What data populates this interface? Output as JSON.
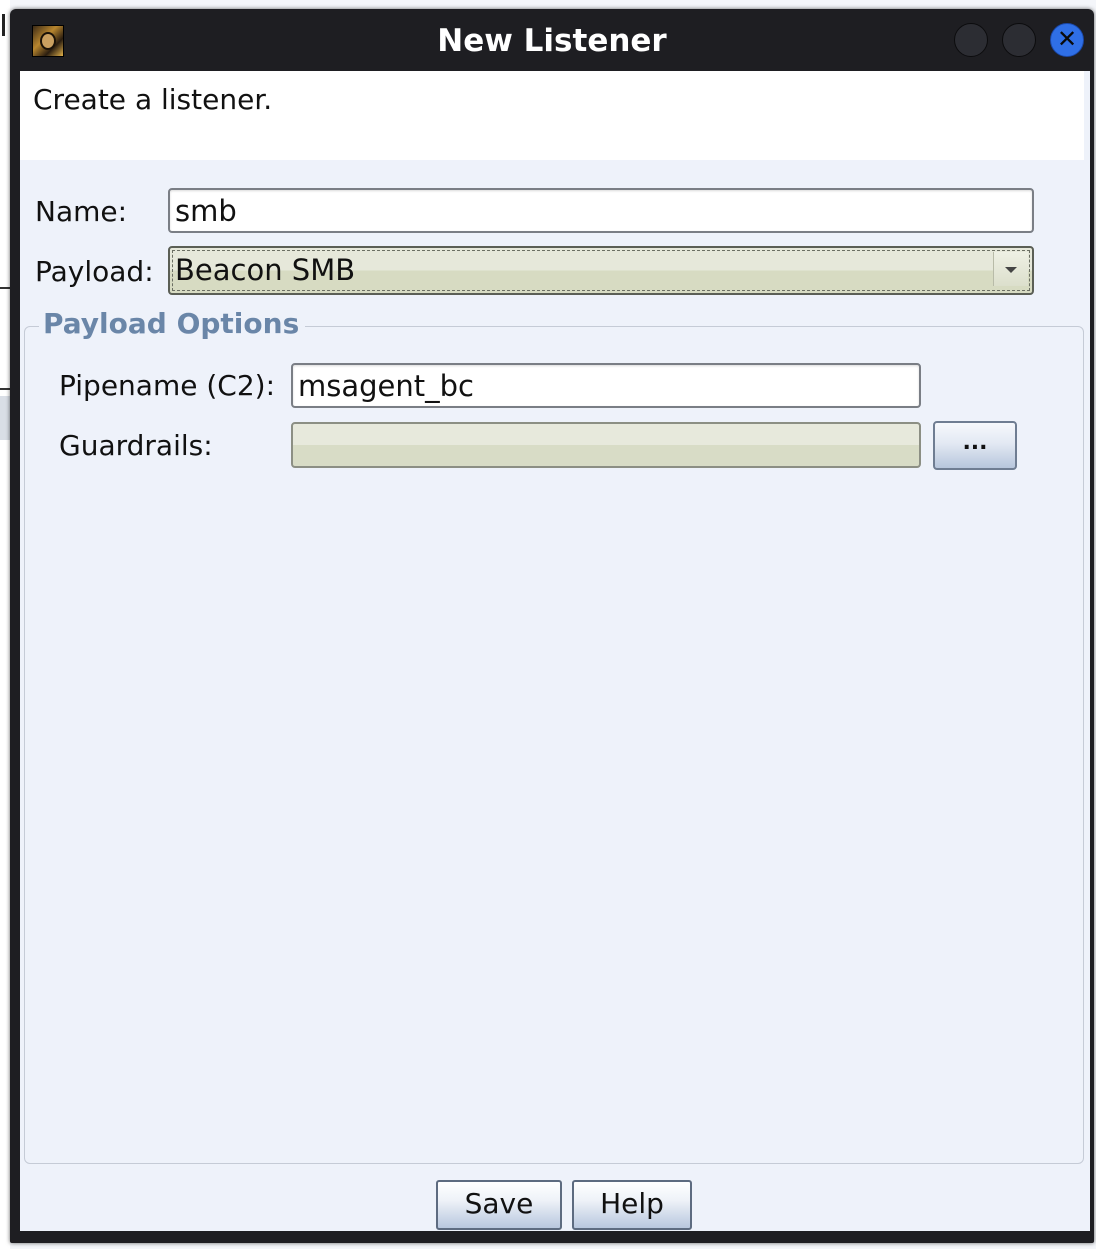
{
  "window": {
    "title": "New Listener",
    "close_glyph": "✕"
  },
  "header": {
    "description": "Create a listener."
  },
  "form": {
    "name_label": "Name:",
    "name_value": "smb",
    "payload_label": "Payload:",
    "payload_value": "Beacon SMB"
  },
  "payload_options": {
    "title": "Payload Options",
    "pipename_label": "Pipename (C2):",
    "pipename_value": "msagent_bc",
    "guardrails_label": "Guardrails:",
    "guardrails_value": "",
    "browse_label": "..."
  },
  "buttons": {
    "save_label": "Save",
    "help_label": "Help"
  },
  "icons": {
    "app": "cobalt-strike-app-icon",
    "minimize": "minimize-icon",
    "maximize": "maximize-icon",
    "close": "close-icon",
    "dropdown": "chevron-down-icon"
  },
  "colors": {
    "titlebar": "#1e1e22",
    "close_button": "#2f6fe6",
    "group_title": "#6a86a8",
    "dialog_bg": "#eef2fa"
  }
}
